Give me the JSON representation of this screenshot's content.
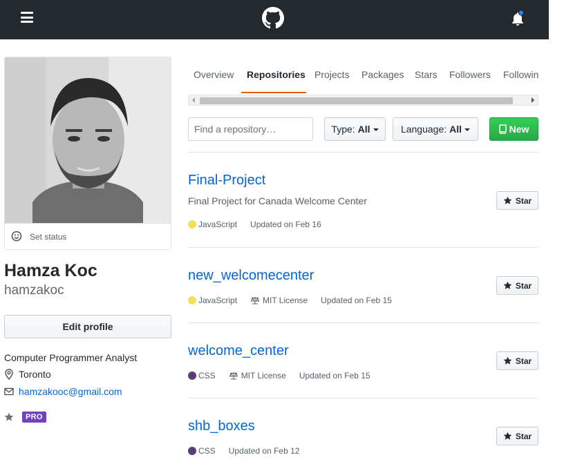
{
  "header": {
    "logo": "github-octocat-icon",
    "menu_icon": "hamburger-icon",
    "notification_icon": "bell-icon",
    "notification_dot_color": "#2188ff"
  },
  "profile": {
    "status_label": "Set status",
    "full_name": "Hamza Koc",
    "login": "hamzakoc",
    "edit_button": "Edit profile",
    "bio": "Computer Programmer Analyst",
    "location": "Toronto",
    "email": "hamzakooc@gmail.com",
    "pro_badge": "PRO"
  },
  "tabs": [
    {
      "label": "Overview",
      "active": false
    },
    {
      "label": "Repositories",
      "active": true
    },
    {
      "label": "Projects",
      "active": false
    },
    {
      "label": "Packages",
      "active": false
    },
    {
      "label": "Stars",
      "active": false
    },
    {
      "label": "Followers",
      "active": false
    },
    {
      "label": "Followin",
      "active": false
    }
  ],
  "filters": {
    "search_placeholder": "Find a repository…",
    "type_label": "Type:",
    "type_value": "All",
    "language_label": "Language:",
    "language_value": "All",
    "new_button": "New"
  },
  "colors": {
    "accent": "#e36209",
    "link": "#0366d6",
    "new_button": "#28a745",
    "pro": "#6f42c1",
    "javascript": "#f1e05a",
    "css": "#563d7c"
  },
  "repos": [
    {
      "name": "Final-Project",
      "description": "Final Project for Canada Welcome Center",
      "language": "JavaScript",
      "language_color": "#f1e05a",
      "license": "",
      "updated": "Updated on Feb 16",
      "star_label": "Star"
    },
    {
      "name": "new_welcomecenter",
      "description": "",
      "language": "JavaScript",
      "language_color": "#f1e05a",
      "license": "MIT License",
      "updated": "Updated on Feb 15",
      "star_label": "Star"
    },
    {
      "name": "welcome_center",
      "description": "",
      "language": "CSS",
      "language_color": "#563d7c",
      "license": "MIT License",
      "updated": "Updated on Feb 15",
      "star_label": "Star"
    },
    {
      "name": "shb_boxes",
      "description": "",
      "language": "CSS",
      "language_color": "#563d7c",
      "license": "",
      "updated": "Updated on Feb 12",
      "star_label": "Star"
    }
  ]
}
